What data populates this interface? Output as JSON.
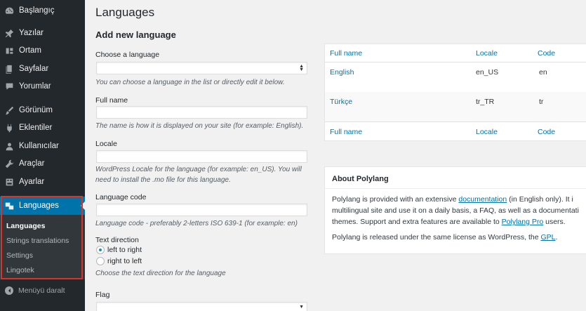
{
  "sidebar": {
    "items": [
      {
        "label": "Başlangıç",
        "icon": "dashboard-icon"
      },
      {
        "label": "Yazılar",
        "icon": "pin-icon"
      },
      {
        "label": "Ortam",
        "icon": "media-icon"
      },
      {
        "label": "Sayfalar",
        "icon": "pages-icon"
      },
      {
        "label": "Yorumlar",
        "icon": "comments-icon"
      },
      {
        "label": "Görünüm",
        "icon": "appearance-icon"
      },
      {
        "label": "Eklentiler",
        "icon": "plugins-icon"
      },
      {
        "label": "Kullanıcılar",
        "icon": "users-icon"
      },
      {
        "label": "Araçlar",
        "icon": "tools-icon"
      },
      {
        "label": "Ayarlar",
        "icon": "settings-icon"
      },
      {
        "label": "Languages",
        "icon": "translation-icon"
      }
    ],
    "submenu": [
      "Languages",
      "Strings translations",
      "Settings",
      "Lingotek"
    ],
    "collapse_label": "Menüyü daralt",
    "highlight_color": "#d9342a",
    "accent_color": "#0073aa"
  },
  "page": {
    "title": "Languages",
    "form_title": "Add new language",
    "choose_label": "Choose a language",
    "choose_desc": "You can choose a language in the list or directly edit it below.",
    "fullname_label": "Full name",
    "fullname_desc": "The name is how it is displayed on your site (for example: English).",
    "locale_label": "Locale",
    "locale_desc": "WordPress Locale for the language (for example: en_US). You will need to install the .mo file for this language.",
    "code_label": "Language code",
    "code_desc": "Language code - preferably 2-letters ISO 639-1 (for example: en)",
    "direction_label": "Text direction",
    "ltr_label": "left to right",
    "rtl_label": "right to left",
    "direction_desc": "Choose the text direction for the language",
    "flag_label": "Flag"
  },
  "table": {
    "headers": [
      "Full name",
      "Locale",
      "Code"
    ],
    "rows": [
      [
        "English",
        "en_US",
        "en"
      ],
      [
        "Türkçe",
        "tr_TR",
        "tr"
      ]
    ]
  },
  "about": {
    "title": "About Polylang",
    "p1_pre": "Polylang is provided with an extensive ",
    "p1_link": "documentation",
    "p1_post": " (in English only). It i",
    "p1_line2": "multilingual site and use it on a daily basis, a FAQ, as well as a documentati",
    "p1_line3_pre": "themes. Support and extra features are available to ",
    "p1_line3_link": "Polylang Pro",
    "p1_line3_post": " users.",
    "p2_pre": "Polylang is released under the same license as WordPress, the ",
    "p2_link": "GPL",
    "p2_post": "."
  }
}
